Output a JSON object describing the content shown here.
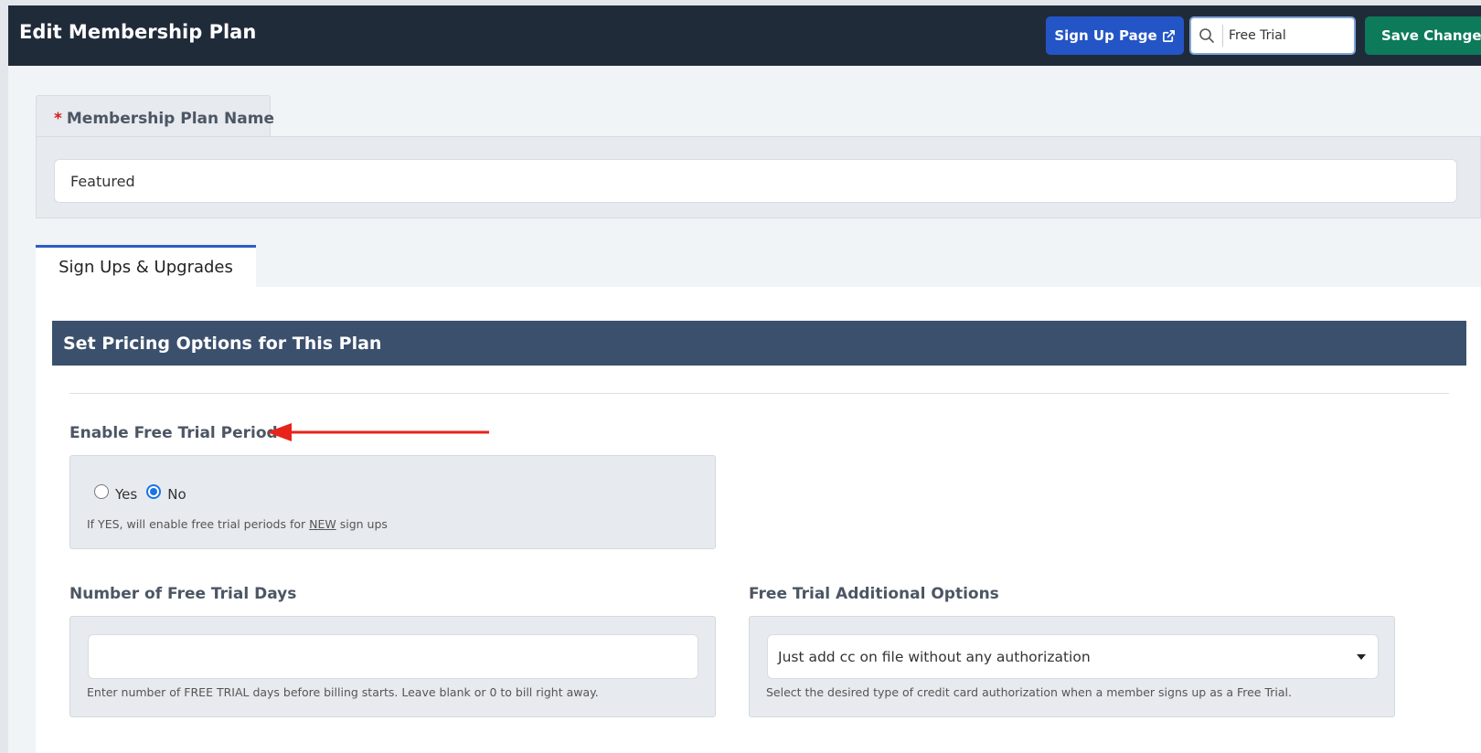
{
  "header": {
    "title": "Edit Membership Plan",
    "signup_button": "Sign Up Page",
    "search_value": "Free Trial",
    "save_button": "Save Changes"
  },
  "plan_name": {
    "tab_label": "Membership Plan Name",
    "required_marker": "*",
    "value": "Featured"
  },
  "tabs": [
    {
      "label": "Sign Ups & Upgrades",
      "active": true
    }
  ],
  "section": {
    "title": "Set Pricing Options for This Plan"
  },
  "free_trial": {
    "label": "Enable Free Trial Period",
    "options": [
      "Yes",
      "No"
    ],
    "selected": "No",
    "help_prefix": "If YES, will enable free trial periods for ",
    "help_emphasis": "NEW",
    "help_suffix": " sign ups"
  },
  "trial_days": {
    "label": "Number of Free Trial Days",
    "value": "",
    "help": "Enter number of FREE TRIAL days before billing starts. Leave blank or 0 to bill right away."
  },
  "trial_options": {
    "label": "Free Trial Additional Options",
    "selected": "Just add cc on file without any authorization",
    "help": "Select the desired type of credit card authorization when a member signs up as a Free Trial."
  },
  "colors": {
    "topbar": "#202b3a",
    "signup_button": "#2455c6",
    "save_button": "#0d7a5a",
    "section_header": "#3b506d",
    "annotation_arrow": "#e8231b"
  }
}
